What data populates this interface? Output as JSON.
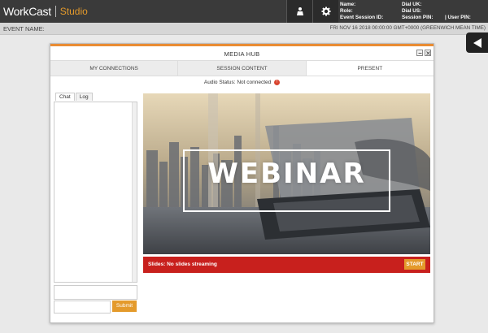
{
  "app": {
    "brand": "WorkCast",
    "product": "Studio"
  },
  "topbar": {
    "icons": [
      "presenter-icon",
      "gear-icon"
    ],
    "info_left": [
      "Name:",
      "Role:",
      "Event Session ID:"
    ],
    "info_right": [
      "Dial UK:",
      "Dial US:",
      "Session PIN:"
    ],
    "user_pin": "| User PIN:"
  },
  "event": {
    "label": "EVENT NAME:",
    "date": "FRI NOV 16 2018 00:00:00 GMT+0000 (GREENWICH MEAN TIME)"
  },
  "panel": {
    "title": "MEDIA HUB",
    "tabs": [
      "MY CONNECTIONS",
      "SESSION CONTENT",
      "PRESENT"
    ],
    "audio_status": "Audio Status: Not connected",
    "audio_badge": "!"
  },
  "chat": {
    "tabs": [
      "Chat",
      "Log"
    ],
    "submit": "Submit"
  },
  "slide": {
    "title": "WEBINAR",
    "status": "Slides: No slides streaming",
    "start": "START"
  },
  "colors": {
    "accent": "#e49a2b",
    "alert": "#c8201d",
    "topbar": "#3a3a3a"
  }
}
